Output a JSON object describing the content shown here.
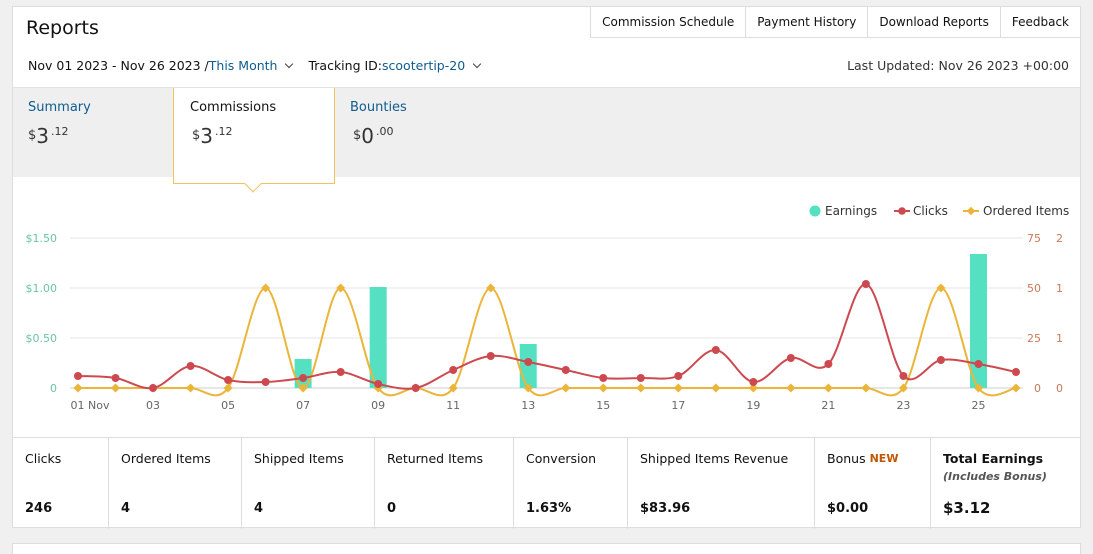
{
  "header": {
    "title": "Reports"
  },
  "topnav": [
    "Commission Schedule",
    "Payment History",
    "Download Reports",
    "Feedback"
  ],
  "filters": {
    "date_range": "Nov 01 2023 - Nov 26 2023 / ",
    "period": "This Month",
    "tracking_label": "Tracking ID: ",
    "tracking_id": "scootertip-20",
    "last_updated": "Last Updated: Nov 26 2023 +00:00"
  },
  "tabs": [
    {
      "label": "Summary",
      "currency": "$",
      "dollars": "3",
      "cents": ".12"
    },
    {
      "label": "Commissions",
      "currency": "$",
      "dollars": "3",
      "cents": ".12"
    },
    {
      "label": "Bounties",
      "currency": "$",
      "dollars": "0",
      "cents": ".00"
    }
  ],
  "legend": {
    "earnings": "Earnings",
    "clicks": "Clicks",
    "ordered": "Ordered Items"
  },
  "colors": {
    "earnings": "#55e0c2",
    "clicks": "#cc4a4f",
    "ordered": "#ebb53a",
    "link": "#0f5c8e",
    "new_badge": "#c45500",
    "tab_border": "#f2c35a"
  },
  "chart_data": {
    "type": "bar+line",
    "x": [
      "01 Nov",
      "02",
      "03",
      "04",
      "05",
      "06",
      "07",
      "08",
      "09",
      "10",
      "11",
      "12",
      "13",
      "14",
      "15",
      "16",
      "17",
      "18",
      "19",
      "20",
      "21",
      "22",
      "23",
      "24",
      "25",
      "26"
    ],
    "xtick_labels": [
      "01 Nov",
      "03",
      "05",
      "07",
      "09",
      "11",
      "13",
      "15",
      "17",
      "19",
      "21",
      "23",
      "25"
    ],
    "left_axis": {
      "ticks": [
        "0",
        "$0.50",
        "$1.00",
        "$1.50"
      ],
      "range": [
        0,
        1.5
      ]
    },
    "right_axis_clicks": {
      "ticks": [
        "0",
        "25",
        "50",
        "75"
      ],
      "range": [
        0,
        75
      ]
    },
    "right_axis_items": {
      "ticks": [
        "0",
        "1",
        "1",
        "2"
      ],
      "range": [
        0,
        1.5
      ]
    },
    "series": [
      {
        "name": "Earnings",
        "kind": "bar",
        "axis": "left",
        "values": [
          0,
          0,
          0,
          0,
          0,
          0,
          0.29,
          0,
          1.01,
          0,
          0,
          0,
          0.44,
          0,
          0,
          0,
          0,
          0,
          0,
          0,
          0,
          0,
          0,
          0,
          1.34,
          0
        ]
      },
      {
        "name": "Clicks",
        "kind": "line",
        "axis": "right",
        "values": [
          6,
          5,
          0,
          11,
          4,
          3,
          5,
          8,
          2,
          0,
          9,
          16,
          13,
          9,
          5,
          5,
          6,
          19,
          3,
          15,
          12,
          52,
          6,
          14,
          12,
          8
        ]
      },
      {
        "name": "Ordered Items",
        "kind": "line",
        "axis": "items",
        "values": [
          0,
          0,
          0,
          0,
          0,
          1,
          0,
          1,
          0,
          0,
          0,
          1,
          0,
          0,
          0,
          0,
          0,
          0,
          0,
          0,
          0,
          0,
          0,
          1,
          0,
          0
        ]
      }
    ]
  },
  "metrics": [
    {
      "label": "Clicks",
      "value": "246"
    },
    {
      "label": "Ordered Items",
      "value": "4"
    },
    {
      "label": "Shipped Items",
      "value": "4"
    },
    {
      "label": "Returned Items",
      "value": "0"
    },
    {
      "label": "Conversion",
      "value": "1.63%"
    },
    {
      "label": "Shipped Items Revenue",
      "value": "$83.96"
    },
    {
      "label": "Bonus",
      "badge": "NEW",
      "value": "$0.00"
    },
    {
      "label": "Total Earnings",
      "sub": "(Includes Bonus)",
      "value": "$3.12"
    }
  ]
}
